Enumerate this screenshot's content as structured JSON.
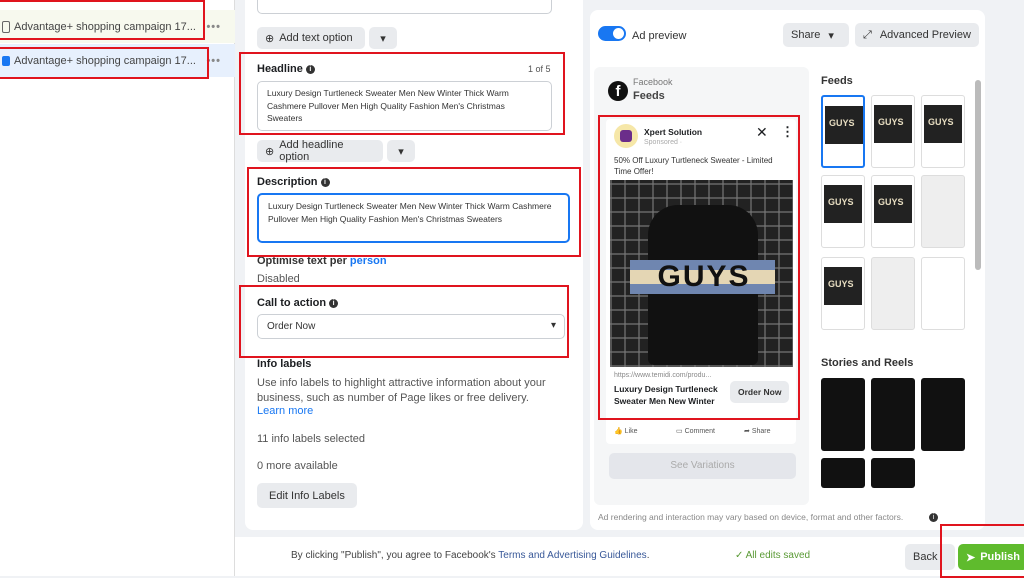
{
  "sidebar": {
    "items": [
      {
        "label": "Advantage+ shopping campaign 17...",
        "icon": "campaign-icon"
      },
      {
        "label": "Advantage+ shopping campaign 17...",
        "icon": "ad-icon"
      }
    ]
  },
  "editor": {
    "add_text_option": "Add text option",
    "headline": {
      "label": "Headline",
      "counter": "1 of 5",
      "value": "Luxury Design Turtleneck Sweater Men New Winter Thick Warm Cashmere Pullover Men High Quality Fashion Men's Christmas Sweaters"
    },
    "add_headline_option": "Add headline option",
    "description": {
      "label": "Description",
      "value": "Luxury Design Turtleneck Sweater Men New Winter Thick Warm Cashmere Pullover Men High Quality Fashion Men's Christmas Sweaters"
    },
    "optimise": {
      "label": "Optimise text per",
      "link": "person",
      "status": "Disabled"
    },
    "cta": {
      "label": "Call to action",
      "value": "Order Now"
    },
    "info_labels": {
      "label": "Info labels",
      "description": "Use info labels to highlight attractive information about your business, such as number of Page likes or free delivery.",
      "learn_more": "Learn more",
      "selected": "11 info labels selected",
      "more": "0 more available",
      "edit_button": "Edit Info Labels"
    }
  },
  "preview": {
    "toggle_label": "Ad preview",
    "toggle_on": true,
    "share": "Share",
    "advanced": "Advanced Preview",
    "platform": "Facebook",
    "placement": "Feeds",
    "ad": {
      "page_name": "Xpert Solution",
      "sponsored": "Sponsored · ",
      "primary_text": "50% Off Luxury Turtleneck Sweater - Limited Time Offer!",
      "image_text": "GUYS",
      "url": "https://www.temidi.com/produ...",
      "headline": "Luxury Design Turtleneck Sweater Men New Winter",
      "cta": "Order Now",
      "like": "Like",
      "comment": "Comment",
      "share": "Share"
    },
    "see_variations": "See Variations",
    "feeds_title": "Feeds",
    "stories_title": "Stories and Reels",
    "disclaimer": "Ad rendering and interaction may vary based on device, format and other factors."
  },
  "footer": {
    "agree_prefix": "By clicking \"Publish\", you agree to Facebook's ",
    "terms_link": "Terms and Advertising Guidelines",
    "agree_suffix": ".",
    "saved": "All edits saved",
    "back": "Back",
    "publish": "Publish"
  },
  "colors": {
    "accent": "#1877f2",
    "publish": "#5fbb2d",
    "highlight": "#e0141e"
  }
}
